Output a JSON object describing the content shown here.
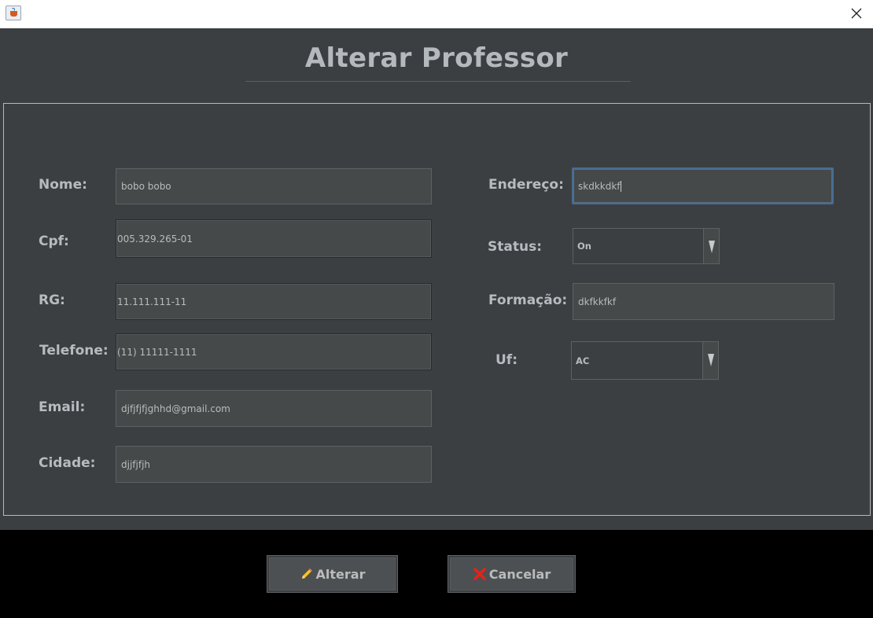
{
  "window": {
    "close_icon": "close-icon",
    "app_icon": "java-cup-icon"
  },
  "title": "Alterar Professor",
  "labels": {
    "nome": "Nome:",
    "cpf": "Cpf:",
    "rg": "RG:",
    "telefone": "Telefone:",
    "email": "Email:",
    "cidade": "Cidade:",
    "endereco": "Endereço:",
    "status": "Status:",
    "formacao": "Formação:",
    "uf": "Uf:"
  },
  "values": {
    "nome": "bobo bobo",
    "cpf": "005.329.265-01",
    "rg": "11.111.111-11",
    "telefone": "(11) 11111-1111",
    "email": "djfjfjfjghhd@gmail.com",
    "cidade": "djjfjfjh",
    "endereco": "skdkkdkf",
    "status": "On",
    "formacao": "dkfkkfkf",
    "uf": "AC"
  },
  "buttons": {
    "alterar": "Alterar",
    "cancelar": "Cancelar"
  },
  "colors": {
    "background": "#3c3f41",
    "field": "#45494a",
    "text": "#bbbbbb",
    "focus": "#466d94",
    "cancel_icon": "#e2231a",
    "footer": "#000000"
  }
}
